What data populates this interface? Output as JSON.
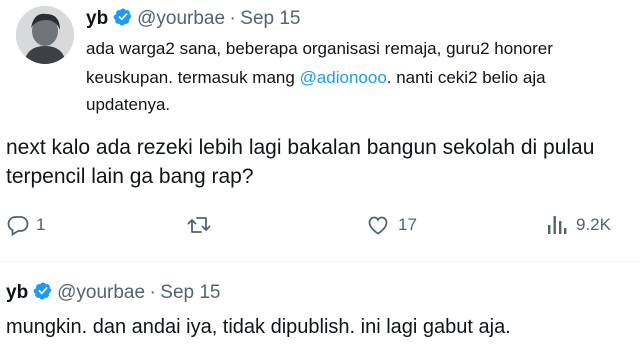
{
  "reply_tweet": {
    "display_name": "yb",
    "handle": "@yourbae",
    "separator": "·",
    "date": "Sep 15",
    "line1": "ada warga2 sana, beberapa organisasi remaja, guru2 honorer",
    "line2_before": "keuskupan. termasuk mang ",
    "mention": "@adionooo",
    "line2_after": ". nanti ceki2 belio aja",
    "line3": "updatenya."
  },
  "main_tweet": {
    "line1": "next kalo ada rezeki lebih lagi bakalan bangun sekolah di pulau",
    "line2": "terpencil lain ga bang rap?"
  },
  "actions": {
    "reply_icon": "reply-icon",
    "reply_count": "1",
    "retweet_icon": "retweet-icon",
    "like_icon": "heart-icon",
    "like_count": "17",
    "views_icon": "views-chart-icon",
    "views_count": "9.2K"
  },
  "second_tweet": {
    "display_name": "yb",
    "handle": "@yourbae",
    "separator": "·",
    "date": "Sep 15",
    "text": "mungkin. dan andai iya, tidak dipublish. ini lagi gabut aja."
  },
  "colors": {
    "verified": "#1d9bf0",
    "mention": "#1d9bf0",
    "secondary_text": "#536471"
  }
}
